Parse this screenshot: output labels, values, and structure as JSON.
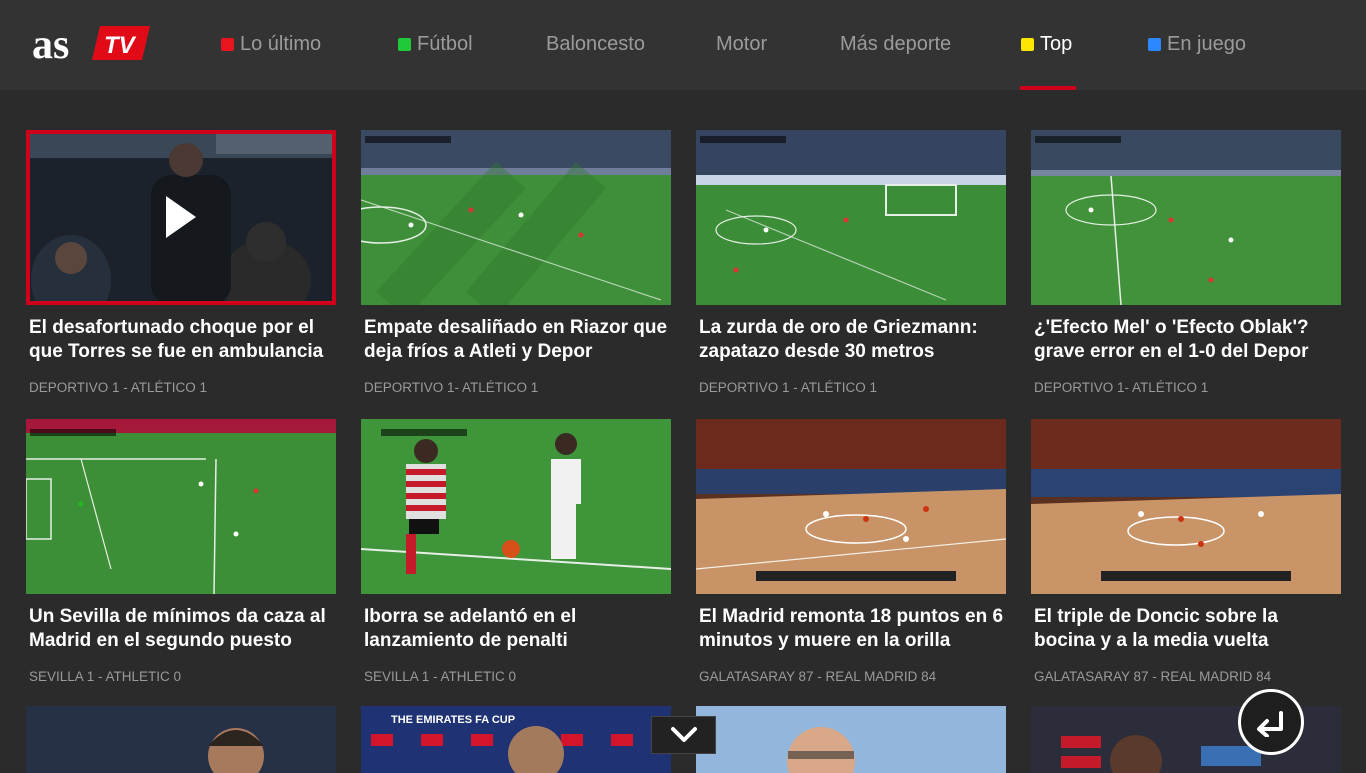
{
  "app": {
    "logo_text": "as",
    "logo_badge": "TV",
    "colors": {
      "accent_red": "#d0021b",
      "background": "#2b2b2b",
      "topbar": "#333333"
    }
  },
  "nav": {
    "items": [
      {
        "label": "Lo último",
        "dot_color": "#e8141e"
      },
      {
        "label": "Fútbol",
        "dot_color": "#1fc93a"
      },
      {
        "label": "Baloncesto",
        "dot_color": ""
      },
      {
        "label": "Motor",
        "dot_color": ""
      },
      {
        "label": "Más deporte",
        "dot_color": ""
      },
      {
        "label": "Top",
        "dot_color": "#ffe600",
        "active": true
      },
      {
        "label": "En juego",
        "dot_color": "#2b88ff"
      }
    ]
  },
  "videos": [
    {
      "title": "El desafortunado choque por el que Torres se fue en ambulancia",
      "meta": "DEPORTIVO 1 - ATLÉTICO 1",
      "selected": true
    },
    {
      "title": "Empate desaliñado en Riazor que deja fríos a Atleti y Depor",
      "meta": "DEPORTIVO 1- ATLÉTICO 1"
    },
    {
      "title": "La zurda de oro de Griezmann: zapatazo desde 30 metros",
      "meta": "DEPORTIVO 1 - ATLÉTICO 1"
    },
    {
      "title": "¿'Efecto Mel' o 'Efecto Oblak'? grave error en el 1-0 del Depor",
      "meta": "DEPORTIVO 1- ATLÉTICO 1"
    },
    {
      "title": "Un Sevilla de mínimos da caza al Madrid en el segundo puesto",
      "meta": "SEVILLA 1 - ATHLETIC 0"
    },
    {
      "title": "Iborra se adelantó en el lanzamiento de penalti",
      "meta": "SEVILLA 1 - ATHLETIC 0"
    },
    {
      "title": "El Madrid remonta 18 puntos en 6 minutos y muere en la orilla",
      "meta": "GALATASARAY 87 - REAL MADRID 84"
    },
    {
      "title": "El triple de Doncic sobre la bocina y a la media vuelta",
      "meta": "GALATASARAY 87 - REAL MADRID 84"
    }
  ],
  "partial_row": {
    "thumb2_banner": "THE EMIRATES FA CUP"
  },
  "controls": {
    "down_icon": "chevron-down-icon",
    "back_icon": "return-arrow-icon"
  }
}
